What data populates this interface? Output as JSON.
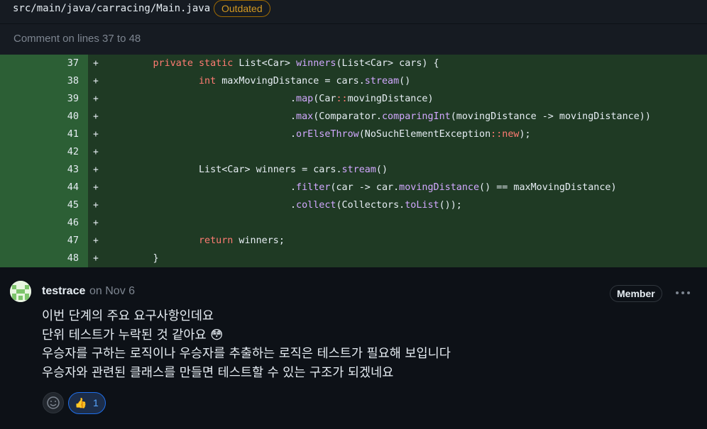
{
  "file": {
    "path": "src/main/java/carracing/Main.java",
    "status_badge": "Outdated",
    "comment_range_label": "Comment on lines 37 to 48"
  },
  "diff": {
    "marker": "+",
    "lines": [
      {
        "number": "37",
        "code": "        private static List<Car> winners(List<Car> cars) {"
      },
      {
        "number": "38",
        "code": "                int maxMovingDistance = cars.stream()"
      },
      {
        "number": "39",
        "code": "                                .map(Car::movingDistance)"
      },
      {
        "number": "40",
        "code": "                                .max(Comparator.comparingInt(movingDistance -> movingDistance))"
      },
      {
        "number": "41",
        "code": "                                .orElseThrow(NoSuchElementException::new);"
      },
      {
        "number": "42",
        "code": ""
      },
      {
        "number": "43",
        "code": "                List<Car> winners = cars.stream()"
      },
      {
        "number": "44",
        "code": "                                .filter(car -> car.movingDistance() == maxMovingDistance)"
      },
      {
        "number": "45",
        "code": "                                .collect(Collectors.toList());"
      },
      {
        "number": "46",
        "code": ""
      },
      {
        "number": "47",
        "code": "                return winners;"
      },
      {
        "number": "48",
        "code": "        }"
      }
    ]
  },
  "comment": {
    "author": "testrace",
    "date": "on Nov 6",
    "role_badge": "Member",
    "body_lines": [
      "이번 단계의 주요 요구사항인데요",
      "단위 테스트가 누락된 것 같아요 😳",
      "우승자를 구하는 로직이나 우승자를 추출하는 로직은 테스트가 필요해 보입니다",
      "우승자와 관련된 클래스를 만들면 테스트할 수 있는 구조가 되겠네요"
    ],
    "reactions": [
      {
        "emoji": "👍",
        "count": "1"
      }
    ]
  },
  "colors": {
    "addition_bg": "#1f3a24",
    "addition_gutter": "#2c5f35",
    "keyword": "#ff7b72",
    "method": "#d2a8ff",
    "badge_outdated": "#d29922",
    "reaction_accent": "#58a6ff"
  },
  "icons": [
    "kebab-menu-icon",
    "smiley-icon",
    "thumbs-up-icon",
    "identicon-avatar"
  ]
}
